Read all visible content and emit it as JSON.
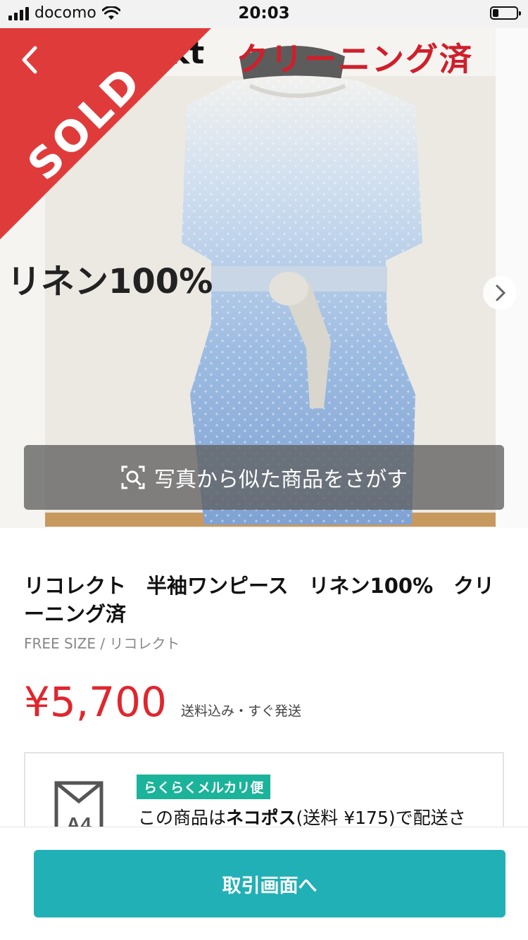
{
  "status_bar": {
    "carrier": "docomo",
    "time": "20:03",
    "battery_level": 0.2
  },
  "photo": {
    "caption_top": "クリーニング済",
    "caption_frag": "kt",
    "caption_left": "リネン100%",
    "sold_label": "SOLD",
    "search_label": "写真から似た商品をさがす"
  },
  "item": {
    "title": "リコレクト　半袖ワンピース　リネン100%　クリーニング済",
    "meta": "FREE SIZE / リコレクト",
    "price": "¥5,700",
    "shipping_note": "送料込み・すぐ発送"
  },
  "shipping": {
    "badge": "らくらくメルカリ便",
    "icon_label": "A4",
    "text_before": "この商品は",
    "text_bold": "ネコポス",
    "text_after": "(送料 ¥175)で配送さ"
  },
  "cta": {
    "label": "取引画面へ"
  },
  "colors": {
    "sold": "#e03b3b",
    "price": "#e0262d",
    "cta": "#21b0b6",
    "badge": "#1bb39a"
  }
}
